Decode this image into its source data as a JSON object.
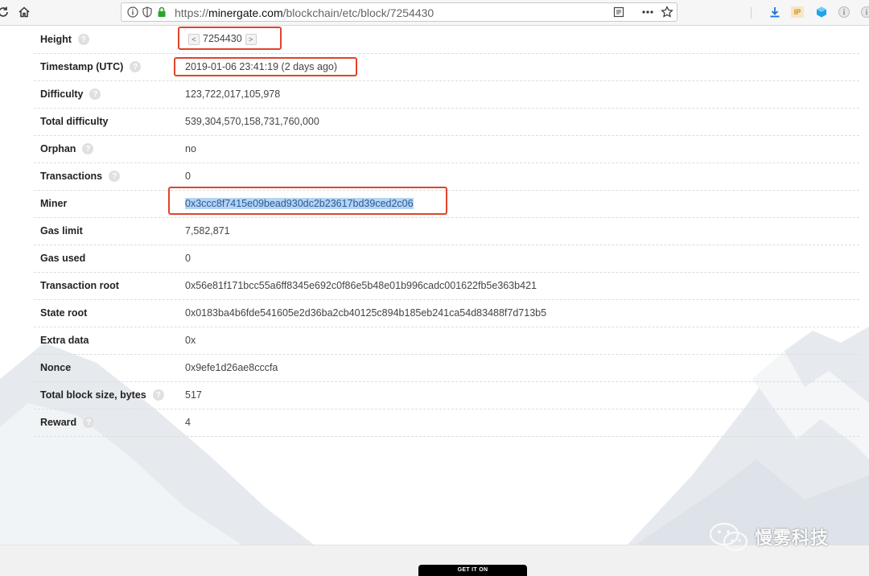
{
  "browser": {
    "url_prefix": "https://",
    "url_domain": "minergate.com",
    "url_path": "/blockchain/etc/block/7254430",
    "ip_badge": "IP"
  },
  "block": {
    "rows": [
      {
        "label": "Height",
        "value": "7254430",
        "help": true
      },
      {
        "label": "Timestamp (UTC)",
        "value": "2019-01-06 23:41:19 (2 days ago)",
        "help": true
      },
      {
        "label": "Difficulty",
        "value": "123,722,017,105,978",
        "help": true
      },
      {
        "label": "Total difficulty",
        "value": "539,304,570,158,731,760,000",
        "help": false
      },
      {
        "label": "Orphan",
        "value": "no",
        "help": true
      },
      {
        "label": "Transactions",
        "value": "0",
        "help": true
      },
      {
        "label": "Miner",
        "value": "0x3ccc8f7415e09bead930dc2b23617bd39ced2c06",
        "help": false
      },
      {
        "label": "Gas limit",
        "value": "7,582,871",
        "help": false
      },
      {
        "label": "Gas used",
        "value": "0",
        "help": false
      },
      {
        "label": "Transaction root",
        "value": "0x56e81f171bcc55a6ff8345e692c0f86e5b48e01b996cadc001622fb5e363b421",
        "help": false
      },
      {
        "label": "State root",
        "value": "0x0183ba4b6fde541605e2d36ba2cb40125c894b185eb241ca54d83488f7d713b5",
        "help": false
      },
      {
        "label": "Extra data",
        "value": "0x",
        "help": false
      },
      {
        "label": "Nonce",
        "value": "0x9efe1d26ae8cccfa",
        "help": false
      },
      {
        "label": "Total block size, bytes",
        "value": "517",
        "help": true
      },
      {
        "label": "Reward",
        "value": "4",
        "help": true
      }
    ],
    "prev_arrow": "<",
    "next_arrow": ">",
    "help_glyph": "?"
  },
  "footer": {
    "store_badge": "GET IT ON"
  },
  "watermark": {
    "text": "慢雾科技"
  },
  "colors": {
    "highlight_box": "#e0442b",
    "selection": "#b5d4f3",
    "mountain": "#e6eaee"
  }
}
